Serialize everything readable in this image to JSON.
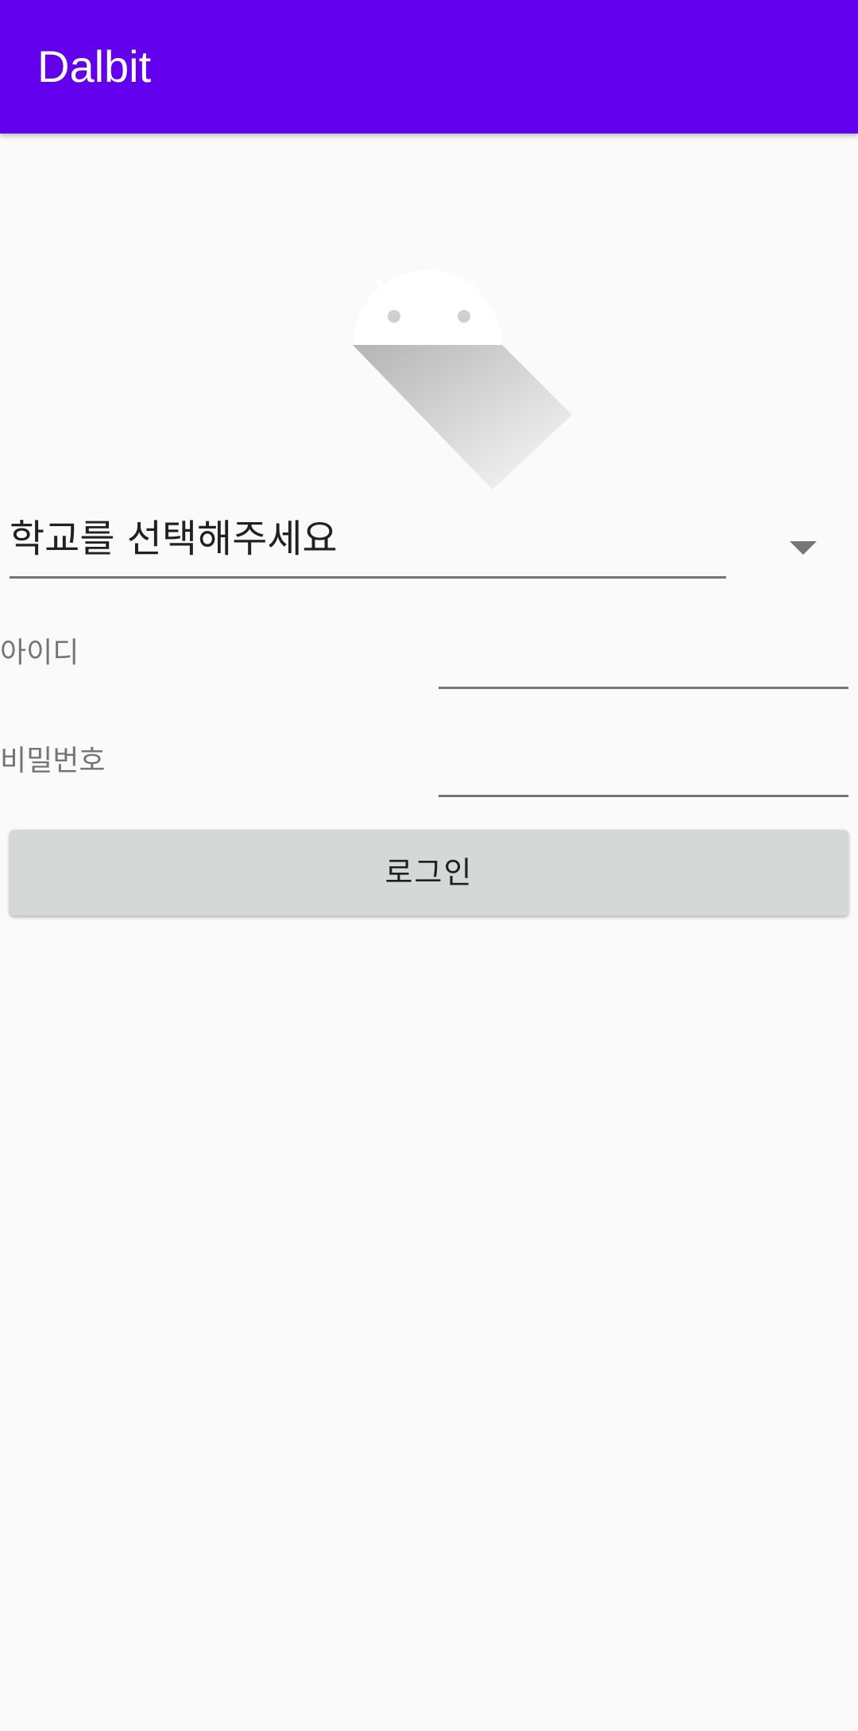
{
  "app_bar": {
    "title": "Dalbit",
    "color": "#6200ee"
  },
  "logo": {
    "icon": "android-icon"
  },
  "school_spinner": {
    "selected": "학교를 선택해주세요",
    "icon": "dropdown-arrow-icon"
  },
  "fields": {
    "id_label": "아이디",
    "id_value": "",
    "password_label": "비밀번호",
    "password_value": ""
  },
  "login_button": {
    "label": "로그인"
  }
}
